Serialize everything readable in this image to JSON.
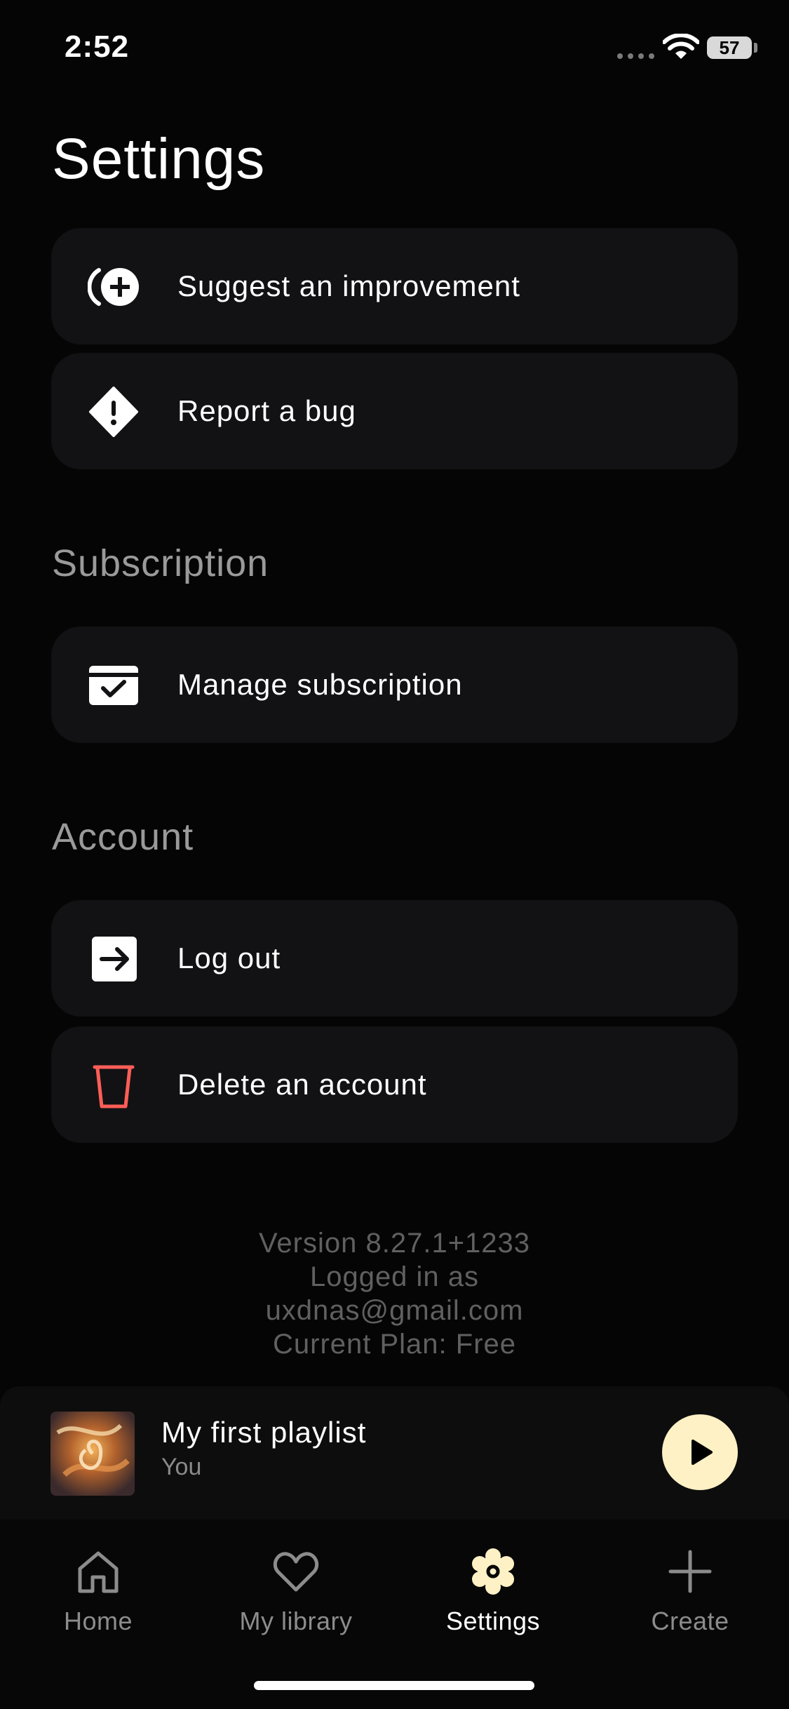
{
  "status_bar": {
    "time": "2:52",
    "battery": "57"
  },
  "page": {
    "title": "Settings"
  },
  "feedback_items": [
    {
      "label": "Suggest an improvement",
      "icon": "lightbulb-plus-icon"
    },
    {
      "label": "Report a bug",
      "icon": "warning-diamond-icon"
    }
  ],
  "subscription": {
    "title": "Subscription",
    "items": [
      {
        "label": "Manage subscription",
        "icon": "subscription-check-icon"
      }
    ]
  },
  "account": {
    "title": "Account",
    "items": [
      {
        "label": "Log out",
        "icon": "logout-arrow-icon"
      },
      {
        "label": "Delete an account",
        "icon": "trash-icon",
        "color": "#ff5e57"
      }
    ]
  },
  "footer": {
    "version": "Version 8.27.1+1233",
    "logged_in_label": "Logged in as",
    "email": "uxdnas@gmail.com",
    "plan": "Current Plan: Free"
  },
  "player": {
    "title": "My first playlist",
    "subtitle": "You",
    "play_icon": "play-icon",
    "accent": "#fef1c5"
  },
  "tabs": [
    {
      "label": "Home",
      "icon": "home-icon",
      "active": false
    },
    {
      "label": "My library",
      "icon": "heart-icon",
      "active": false
    },
    {
      "label": "Settings",
      "icon": "gear-icon",
      "active": true
    },
    {
      "label": "Create",
      "icon": "plus-icon",
      "active": false
    }
  ]
}
